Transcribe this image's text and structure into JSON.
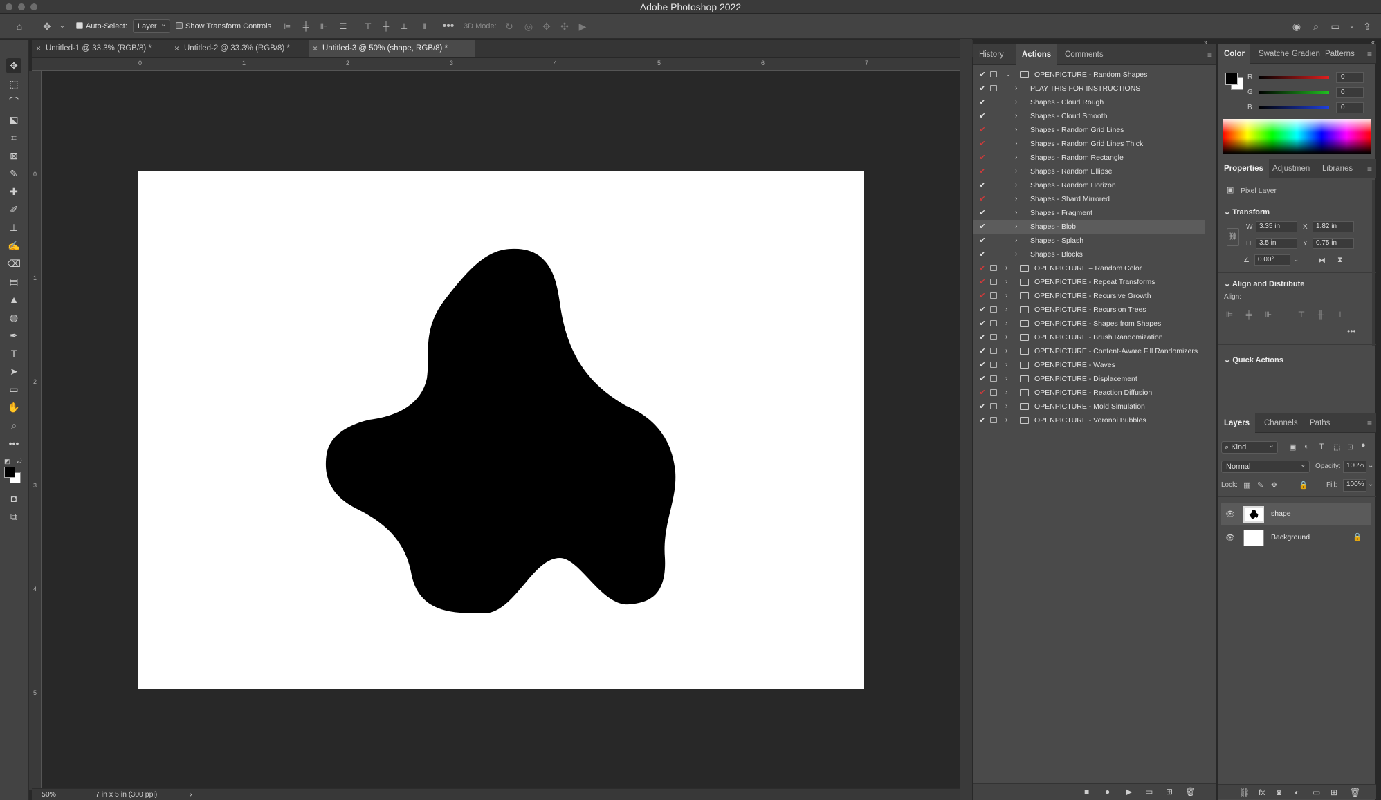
{
  "app": {
    "title": "Adobe Photoshop 2022"
  },
  "options_bar": {
    "auto_select_label": "Auto-Select:",
    "auto_select_value": "Layer",
    "show_transform_label": "Show Transform Controls",
    "mode_3d_label": "3D Mode:"
  },
  "doc_tabs": [
    {
      "label": "Untitled-1 @ 33.3% (RGB/8) *"
    },
    {
      "label": "Untitled-2 @ 33.3% (RGB/8) *"
    },
    {
      "label": "Untitled-3 @ 50% (shape, RGB/8) *"
    }
  ],
  "ruler": {
    "top": [
      "0",
      "1",
      "2",
      "3",
      "4",
      "5",
      "6",
      "7"
    ],
    "left": [
      "0",
      "1",
      "2",
      "3",
      "4",
      "5"
    ]
  },
  "status": {
    "zoom": "50%",
    "doc_size": "7 in x 5 in (300 ppi)"
  },
  "actions_panel": {
    "tabs": [
      "History",
      "Actions",
      "Comments"
    ],
    "rows": [
      {
        "label": "OPENPICTURE - Random Shapes",
        "level": 0,
        "open": true,
        "check": "white",
        "dialog": "plain",
        "selected": false
      },
      {
        "label": "PLAY THIS FOR INSTRUCTIONS",
        "level": 1,
        "check": "white",
        "dialog": "plain",
        "selected": false
      },
      {
        "label": "Shapes - Cloud Rough",
        "level": 1,
        "check": "white",
        "dialog": "none",
        "selected": false
      },
      {
        "label": "Shapes - Cloud Smooth",
        "level": 1,
        "check": "white",
        "dialog": "none",
        "selected": false
      },
      {
        "label": "Shapes - Random Grid Lines",
        "level": 1,
        "check": "red",
        "dialog": "none",
        "selected": false
      },
      {
        "label": "Shapes - Random Grid Lines Thick",
        "level": 1,
        "check": "red",
        "dialog": "none",
        "selected": false
      },
      {
        "label": "Shapes - Random Rectangle",
        "level": 1,
        "check": "red",
        "dialog": "none",
        "selected": false
      },
      {
        "label": "Shapes - Random Ellipse",
        "level": 1,
        "check": "red",
        "dialog": "none",
        "selected": false
      },
      {
        "label": "Shapes - Random Horizon",
        "level": 1,
        "check": "white",
        "dialog": "none",
        "selected": false
      },
      {
        "label": "Shapes - Shard Mirrored",
        "level": 1,
        "check": "red",
        "dialog": "none",
        "selected": false
      },
      {
        "label": "Shapes - Fragment",
        "level": 1,
        "check": "white",
        "dialog": "none",
        "selected": false
      },
      {
        "label": "Shapes - Blob",
        "level": 1,
        "check": "white",
        "dialog": "none",
        "selected": true
      },
      {
        "label": "Shapes - Splash",
        "level": 1,
        "check": "white",
        "dialog": "none",
        "selected": false
      },
      {
        "label": "Shapes - Blocks",
        "level": 1,
        "check": "white",
        "dialog": "none",
        "selected": false
      },
      {
        "label": "OPENPICTURE – Random Color",
        "level": 0,
        "check": "red",
        "dialog": "plain",
        "selected": false
      },
      {
        "label": "OPENPICTURE - Repeat Transforms",
        "level": 0,
        "check": "red",
        "dialog": "plain",
        "selected": false
      },
      {
        "label": "OPENPICTURE - Recursive Growth",
        "level": 0,
        "check": "red",
        "dialog": "plain",
        "selected": false
      },
      {
        "label": "OPENPICTURE - Recursion Trees",
        "level": 0,
        "check": "white",
        "dialog": "plain",
        "selected": false
      },
      {
        "label": "OPENPICTURE - Shapes from Shapes",
        "level": 0,
        "check": "white",
        "dialog": "plain",
        "selected": false
      },
      {
        "label": "OPENPICTURE - Brush Randomization",
        "level": 0,
        "check": "white",
        "dialog": "plain",
        "selected": false
      },
      {
        "label": "OPENPICTURE - Content-Aware Fill Randomizers",
        "level": 0,
        "check": "white",
        "dialog": "plain",
        "selected": false
      },
      {
        "label": "OPENPICTURE - Waves",
        "level": 0,
        "check": "white",
        "dialog": "plain",
        "selected": false
      },
      {
        "label": "OPENPICTURE - Displacement",
        "level": 0,
        "check": "white",
        "dialog": "plain",
        "selected": false
      },
      {
        "label": "OPENPICTURE - Reaction Diffusion",
        "level": 0,
        "check": "red",
        "dialog": "plain",
        "selected": false
      },
      {
        "label": "OPENPICTURE - Mold Simulation",
        "level": 0,
        "check": "white",
        "dialog": "plain",
        "selected": false
      },
      {
        "label": "OPENPICTURE - Voronoi Bubbles",
        "level": 0,
        "check": "white",
        "dialog": "plain",
        "selected": false
      }
    ]
  },
  "color_panel": {
    "tabs": [
      "Color",
      "Swatche",
      "Gradien",
      "Patterns"
    ],
    "r_label": "R",
    "g_label": "G",
    "b_label": "B",
    "r": "0",
    "g": "0",
    "b": "0",
    "colors": {
      "r_track": "#e02020",
      "g_track": "#20c020",
      "b_track": "#2040e0",
      "foreground": "#000000",
      "background": "#ffffff"
    }
  },
  "properties_panel": {
    "tabs": [
      "Properties",
      "Adjustmen",
      "Libraries"
    ],
    "layer_type": "Pixel Layer",
    "transform_heading": "Transform",
    "w_label": "W",
    "w": "3.35 in",
    "x_label": "X",
    "x": "1.82 in",
    "h_label": "H",
    "h": "3.5 in",
    "y_label": "Y",
    "y": "0.75 in",
    "angle": "0.00°",
    "align_heading": "Align and Distribute",
    "align_label": "Align:",
    "quick_actions_heading": "Quick Actions"
  },
  "layers_panel": {
    "tabs": [
      "Layers",
      "Channels",
      "Paths"
    ],
    "filter_kind": "Kind",
    "blend_mode": "Normal",
    "opacity_label": "Opacity:",
    "opacity": "100%",
    "lock_label": "Lock:",
    "fill_label": "Fill:",
    "fill": "100%",
    "layers": [
      {
        "name": "shape",
        "selected": true,
        "locked": false
      },
      {
        "name": "Background",
        "selected": false,
        "locked": true
      }
    ]
  }
}
